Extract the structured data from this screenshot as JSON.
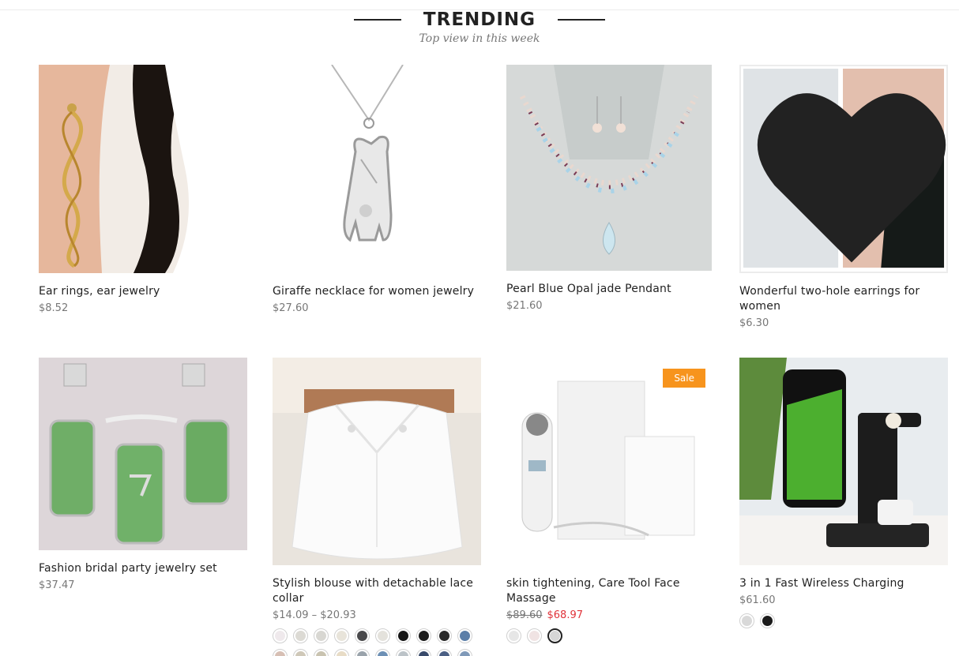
{
  "section": {
    "title": "TRENDING",
    "subtitle": "Top view in this week"
  },
  "products": [
    {
      "name": "Ear rings, ear jewelry",
      "price": "$8.52",
      "image": "gold-spiral-earring-photo"
    },
    {
      "name": "Giraffe necklace for women jewelry",
      "price": "$27.60",
      "image": "silver-giraffe-pendant-photo"
    },
    {
      "name": "Pearl Blue Opal jade Pendant",
      "price": "$21.60",
      "image": "pearl-opal-necklace-photo"
    },
    {
      "name": "Wonderful two-hole earrings for women",
      "price": "$6.30",
      "image": "gold-chain-hoop-earrings-photo",
      "wishlist_icon": "heart-icon"
    },
    {
      "name": "Fashion bridal party jewelry set",
      "price": "$37.47",
      "image": "green-jade-jewelry-set-photo"
    },
    {
      "name": "Stylish blouse with detachable lace collar",
      "price": "$14.09 – $20.93",
      "image": "white-detachable-collar-photo",
      "swatches": [
        "#efe9ec",
        "#dcdad4",
        "#d8d7d2",
        "#e8e4da",
        "#4a4a4c",
        "#e4e2dc",
        "#151515",
        "#1c1c1c",
        "#2a2a2a",
        "#5b7ea8",
        "#d7bfb4",
        "#cfc8b8",
        "#c9c3b0",
        "#e8dcc6",
        "#9aa3ab",
        "#6d90b5",
        "#bcc3c8",
        "#384a6a",
        "#4b5f84",
        "#7f99b8"
      ]
    },
    {
      "name": "skin tightening, Care Tool Face Massage",
      "price_old": "$89.60",
      "price_new": "$68.97",
      "badge": "Sale",
      "image": "face-massager-device-photo",
      "swatches": [
        "#e6e6e6",
        "#f0e3e3",
        "#d6d6d6"
      ]
    },
    {
      "name": "3 in 1 Fast Wireless Charging",
      "price": "$61.60",
      "image": "wireless-charging-stand-photo",
      "swatches": [
        "#d9d9d9",
        "#1a1a1a"
      ]
    }
  ],
  "colors": {
    "sale_badge": "#f7941d",
    "sale_price": "#e0333a",
    "muted_text": "#777777"
  }
}
